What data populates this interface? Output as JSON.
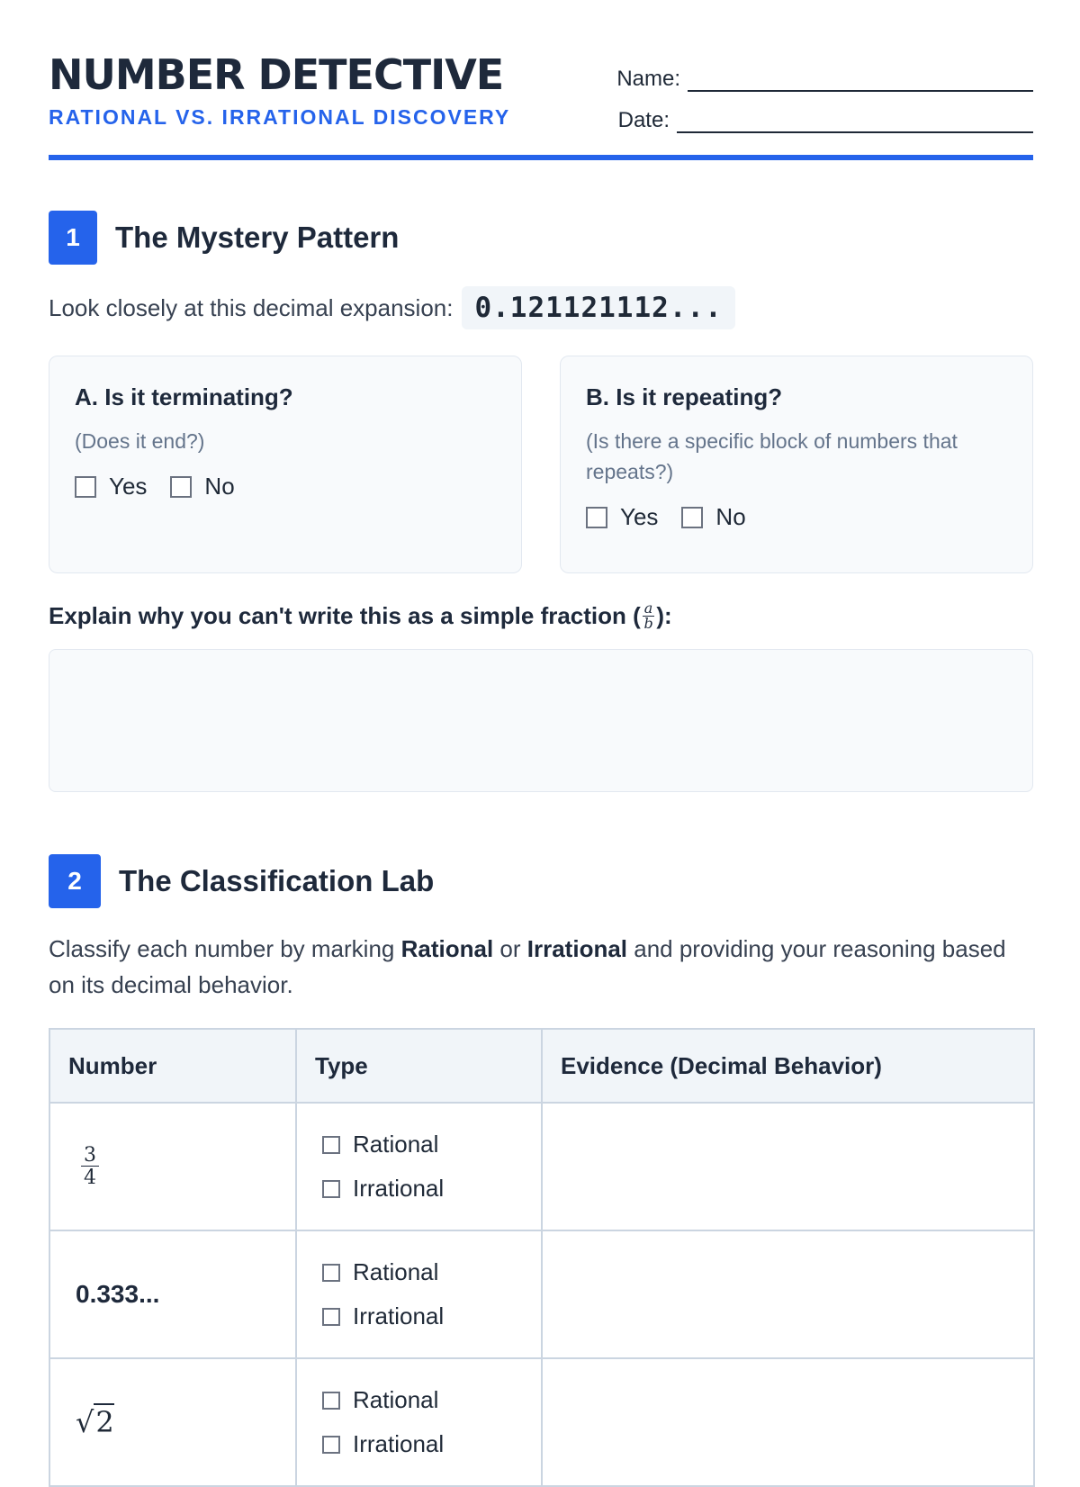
{
  "header": {
    "title": "NUMBER DETECTIVE",
    "subtitle": "RATIONAL VS. IRRATIONAL DISCOVERY",
    "name_label": "Name:",
    "date_label": "Date:"
  },
  "section1": {
    "number": "1",
    "title": "The Mystery Pattern",
    "prompt": "Look closely at this decimal expansion:",
    "decimal": "0.121121112...",
    "card_a": {
      "question": "A. Is it terminating?",
      "hint": "(Does it end?)",
      "yes": "Yes",
      "no": "No"
    },
    "card_b": {
      "question": "B. Is it repeating?",
      "hint": "(Is there a specific block of numbers that repeats?)",
      "yes": "Yes",
      "no": "No"
    },
    "explain_before": "Explain why you can't write this as a simple fraction (",
    "explain_num": "a",
    "explain_den": "b",
    "explain_after": "):"
  },
  "section2": {
    "number": "2",
    "title": "The Classification Lab",
    "intro_1": "Classify each number by marking ",
    "intro_rational": "Rational",
    "intro_or": " or ",
    "intro_irrational": "Irrational",
    "intro_2": " and providing your reasoning based on its decimal behavior.",
    "table": {
      "headers": [
        "Number",
        "Type",
        "Evidence (Decimal Behavior)"
      ],
      "rows": [
        {
          "frac_num": "3",
          "frac_den": "4",
          "opt1": "Rational",
          "opt2": "Irrational"
        },
        {
          "text": "0.333...",
          "opt1": "Rational",
          "opt2": "Irrational"
        },
        {
          "sqrt_sign": "√",
          "sqrt_value": "2",
          "opt1": "Rational",
          "opt2": "Irrational"
        }
      ]
    }
  },
  "colors": {
    "accent": "#2563eb",
    "heading": "#1e293b",
    "muted": "#64748b"
  }
}
